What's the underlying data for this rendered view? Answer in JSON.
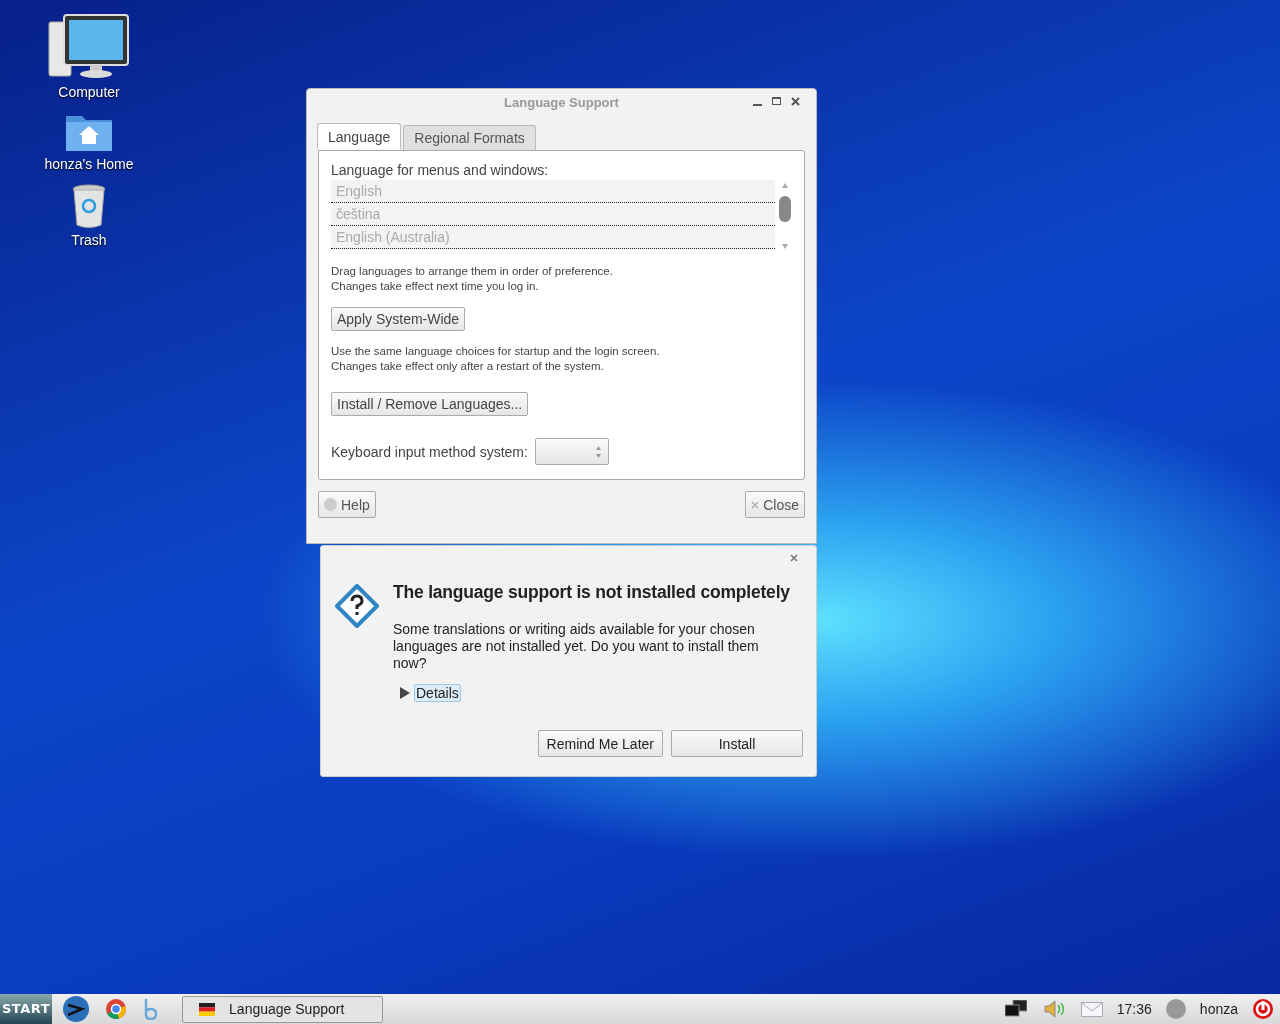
{
  "desktop_icons": [
    {
      "kind": "computer",
      "label": "Computer"
    },
    {
      "kind": "home",
      "label": "honza's Home"
    },
    {
      "kind": "trash",
      "label": "Trash"
    }
  ],
  "window": {
    "title": "Language Support",
    "tabs": [
      {
        "label": "Language",
        "selected": true
      },
      {
        "label": "Regional Formats",
        "selected": false
      }
    ],
    "list_label": "Language for menus and windows:",
    "languages": {
      "disabled": true,
      "items": [
        "English",
        "čeština",
        "English (Australia)"
      ]
    },
    "list_note": [
      "Drag languages to arrange them in order of preference.",
      "Changes take effect next time you log in."
    ],
    "apply_button": "Apply System-Wide",
    "apply_note": [
      "Use the same language choices for startup and the login screen.",
      "Changes take effect only after a restart of the system."
    ],
    "install_button": "Install / Remove Languages...",
    "keyboard_label": "Keyboard input method system:",
    "help_button": "Help",
    "close_button": "Close"
  },
  "dialog": {
    "title": "The language support is not installed completely",
    "message": "Some translations or writing aids available for your chosen languages are not installed yet. Do you want to install them now?",
    "details": {
      "label": "Details",
      "expanded": false
    },
    "buttons": [
      "Remind Me Later",
      "Install"
    ]
  },
  "taskbar": {
    "start": "START",
    "tasks": [
      {
        "label": "Language Support",
        "selected": false
      }
    ],
    "clock": "17:36",
    "user": "honza"
  }
}
